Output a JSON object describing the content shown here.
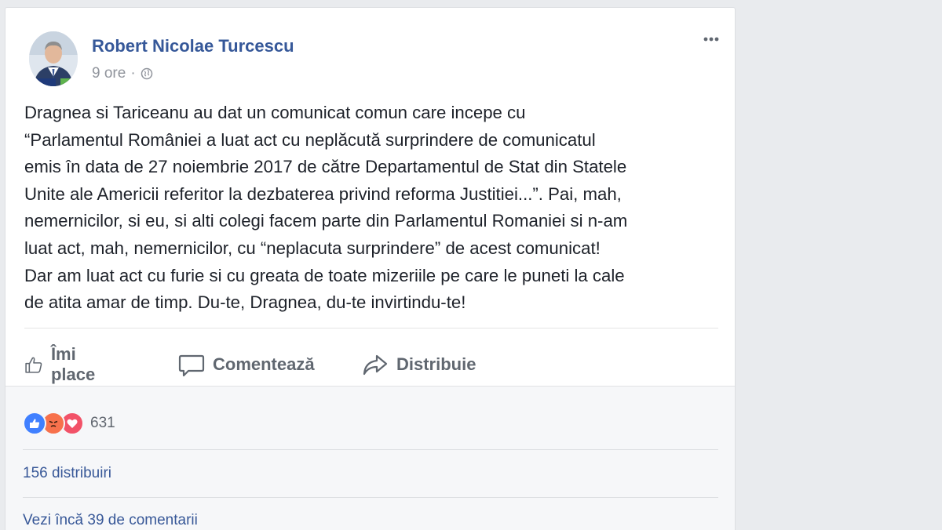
{
  "post": {
    "author": "Robert Nicolae Turcescu",
    "time": "9 ore",
    "separator": "·",
    "privacy_icon": "globe-icon",
    "text_lines": [
      "Dragnea si Tariceanu au dat un comunicat comun care incepe cu",
      "“Parlamentul României a luat act cu neplăcută surprindere de comunicatul",
      "emis în data de 27 noiembrie 2017 de către Departamentul de Stat din Statele",
      "Unite ale Americii referitor la dezbaterea privind reforma Justitiei...”. Pai, mah,",
      "nemernicilor, si eu, si alti colegi facem parte din Parlamentul Romaniei si n-am",
      "luat act, mah, nemernicilor, cu “neplacuta surprindere” de acest comunicat!",
      "Dar am luat act cu furie si cu greata de toate mizeriile pe care le puneti la cale",
      "de atita amar de timp. Du-te, Dragnea, du-te invirtindu-te!"
    ]
  },
  "actions": {
    "like_label": "Îmi place",
    "comment_label": "Comentează",
    "share_label": "Distribuie"
  },
  "footer": {
    "reactions": [
      "like-icon",
      "angry-icon",
      "love-icon"
    ],
    "reaction_count": "631",
    "shares": "156 distribuiri",
    "more_comments": "Vezi încă 39 de comentarii"
  },
  "colors": {
    "name_blue": "#365899",
    "like_blue": "#4080ff",
    "angry_orange": "#f7714c",
    "love_red": "#f25268"
  }
}
